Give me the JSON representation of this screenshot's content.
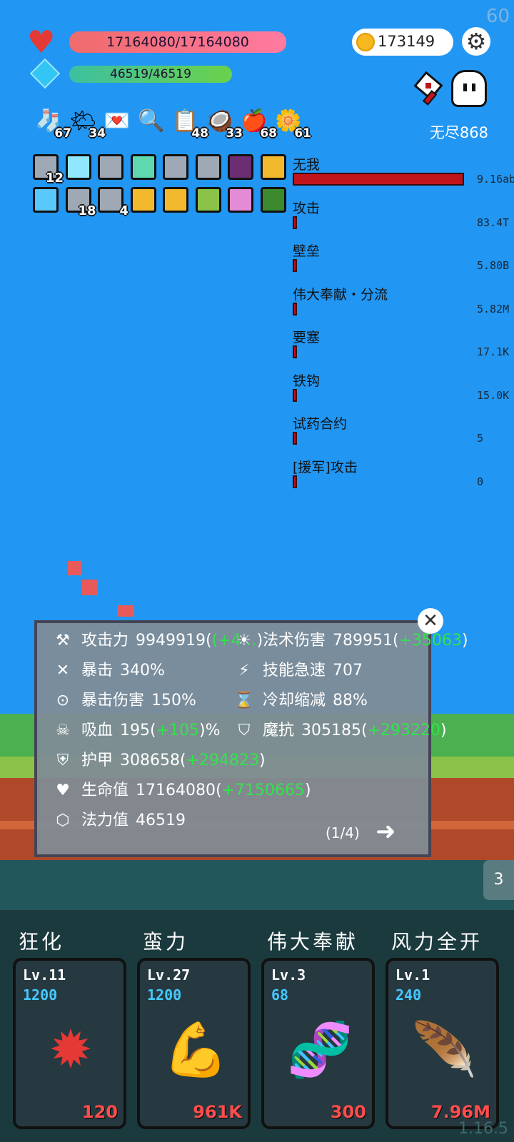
{
  "fps": "60",
  "version": "1.16.5",
  "player": {
    "hp": "17164080/17164080",
    "mp": "46519/46519"
  },
  "coins": "173149",
  "mode_label": "无尽868",
  "items": [
    {
      "icon": "sock-icon",
      "count": "67"
    },
    {
      "icon": "sun-icon",
      "count": "34"
    },
    {
      "icon": "letter-icon",
      "count": ""
    },
    {
      "icon": "magnifier-icon",
      "count": ""
    },
    {
      "icon": "clipboard-icon",
      "count": "48"
    },
    {
      "icon": "coconut-icon",
      "count": "33"
    },
    {
      "icon": "apple-icon",
      "count": "68"
    },
    {
      "icon": "flower-icon",
      "count": "61"
    }
  ],
  "equipment": [
    {
      "icon": "sword-icon",
      "count": "12",
      "color": "#9fa8b5"
    },
    {
      "icon": "bulb-icon",
      "count": "",
      "color": "#8fe8ff"
    },
    {
      "icon": "sword-icon",
      "count": "",
      "color": "#9fa8b5"
    },
    {
      "icon": "skull-icon",
      "count": "",
      "color": "#5fd8b0"
    },
    {
      "icon": "sword-icon",
      "count": "",
      "color": "#9fa8b5"
    },
    {
      "icon": "sword-icon",
      "count": "",
      "color": "#9fa8b5"
    },
    {
      "icon": "demon-icon",
      "count": "",
      "color": "#6b2e73"
    },
    {
      "icon": "cube-icon",
      "count": "",
      "color": "#f2b92d"
    },
    {
      "icon": "splash-icon",
      "count": "",
      "color": "#5ac8fa"
    },
    {
      "icon": "sword-icon",
      "count": "18",
      "color": "#9fa8b5"
    },
    {
      "icon": "sword-icon",
      "count": "4",
      "color": "#9fa8b5"
    },
    {
      "icon": "face-icon",
      "count": "",
      "color": "#f2b92d"
    },
    {
      "icon": "cube-icon",
      "count": "",
      "color": "#f2b92d"
    },
    {
      "icon": "hammer-icon",
      "count": "",
      "color": "#8bc34a"
    },
    {
      "icon": "totem-icon",
      "count": "",
      "color": "#e48bd6"
    },
    {
      "icon": "rune-icon",
      "count": "",
      "color": "#3c8a2d"
    }
  ],
  "damage_stats": [
    {
      "name": "无我",
      "value": "9.16ab",
      "ratio": 1.0
    },
    {
      "name": "攻击",
      "value": "83.4T",
      "ratio": 0.0
    },
    {
      "name": "壁垒",
      "value": "5.80B",
      "ratio": 0.0
    },
    {
      "name": "伟大奉献・分流",
      "value": "5.82M",
      "ratio": 0.0
    },
    {
      "name": "要塞",
      "value": "17.1K",
      "ratio": 0.0
    },
    {
      "name": "铁钩",
      "value": "15.0K",
      "ratio": 0.0
    },
    {
      "name": "试药合约",
      "value": "5",
      "ratio": 0.0
    },
    {
      "name": "[援军]攻击",
      "value": "0",
      "ratio": 0.0
    }
  ],
  "stats_panel": {
    "page": "(1/4)",
    "left": [
      {
        "icon": "axe-icon",
        "glyph": "⚒",
        "label": "攻击力",
        "value": "9949919",
        "bonus": "(+4…",
        "bonus_plus": ""
      },
      {
        "icon": "crit-icon",
        "glyph": "✕",
        "label": "暴击",
        "value": "340%",
        "bonus": "",
        "bonus_plus": ""
      },
      {
        "icon": "crit-damage-icon",
        "glyph": "⊙",
        "label": "暴击伤害",
        "value": "150%",
        "bonus": "",
        "bonus_plus": ""
      },
      {
        "icon": "horned-skull-icon",
        "glyph": "☠",
        "label": "吸血",
        "value": "195",
        "bonus": "+105",
        "bonus_plus": "%"
      },
      {
        "icon": "shield-icon",
        "glyph": "⛨",
        "label": "护甲",
        "value": "308658",
        "bonus": "+294823",
        "bonus_plus": ""
      },
      {
        "icon": "heart-icon",
        "glyph": "♥",
        "label": "生命值",
        "value": "17164080",
        "bonus": "+7150665",
        "bonus_plus": ""
      },
      {
        "icon": "mana-gem-icon",
        "glyph": "⬡",
        "label": "法力值",
        "value": "46519",
        "bonus": "",
        "bonus_plus": ""
      }
    ],
    "right": [
      {
        "icon": "sun-burst-icon",
        "glyph": "☀",
        "label": "法术伤害",
        "value": "789951",
        "bonus": "+35063",
        "bonus_plus": ""
      },
      {
        "icon": "lightning-icon",
        "glyph": "⚡",
        "label": "技能急速",
        "value": "707",
        "bonus": "",
        "bonus_plus": ""
      },
      {
        "icon": "hourglass-icon",
        "glyph": "⌛",
        "label": "冷却缩减",
        "value": "88%",
        "bonus": "",
        "bonus_plus": ""
      },
      {
        "icon": "magic-shield-icon",
        "glyph": "⛉",
        "label": "魔抗",
        "value": "305185",
        "bonus": "+293220",
        "bonus_plus": ""
      }
    ]
  },
  "side_tab": "3",
  "skills": [
    {
      "name": "狂化",
      "level": "Lv.11",
      "cost": "1200",
      "damage": "120",
      "icon": "blood-splat-icon",
      "glyph": "✹",
      "color": "#e53935"
    },
    {
      "name": "蛮力",
      "level": "Lv.27",
      "cost": "1200",
      "damage": "961K",
      "icon": "muscle-arm-icon",
      "glyph": "💪",
      "color": "#f2c7a4"
    },
    {
      "name": "伟大奉献",
      "level": "Lv.3",
      "cost": "68",
      "damage": "300",
      "icon": "dna-icon",
      "glyph": "🧬",
      "color": "#d9345a"
    },
    {
      "name": "风力全开",
      "level": "Lv.1",
      "cost": "240",
      "damage": "7.96M",
      "icon": "feather-icon",
      "glyph": "🪶",
      "color": "#5a9bf0"
    }
  ]
}
